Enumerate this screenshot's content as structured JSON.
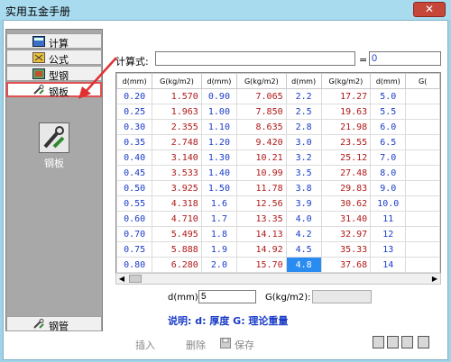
{
  "window": {
    "title": "实用五金手册",
    "close": "✕"
  },
  "nav": {
    "items": [
      {
        "label": "计算",
        "icon": "calculator-icon"
      },
      {
        "label": "公式",
        "icon": "formula-icon"
      },
      {
        "label": "型钢",
        "icon": "steel-section-icon"
      },
      {
        "label": "钢板",
        "icon": "wrench-icon"
      }
    ],
    "active_tool_label": "钢板",
    "bottom_item": {
      "label": "钢管",
      "icon": "wrench-icon"
    }
  },
  "calc": {
    "label": "计算式:",
    "expression": "",
    "equals": "=",
    "result": "0"
  },
  "grid": {
    "headers": [
      "d(mm)",
      "G(kg/m2)",
      "d(mm)",
      "G(kg/m2)",
      "d(mm)",
      "G(kg/m2)",
      "d(mm)",
      "G("
    ],
    "rows": [
      [
        "0.20",
        "1.570",
        "0.90",
        "7.065",
        "2.2",
        "17.27",
        "5.0",
        ""
      ],
      [
        "0.25",
        "1.963",
        "1.00",
        "7.850",
        "2.5",
        "19.63",
        "5.5",
        ""
      ],
      [
        "0.30",
        "2.355",
        "1.10",
        "8.635",
        "2.8",
        "21.98",
        "6.0",
        ""
      ],
      [
        "0.35",
        "2.748",
        "1.20",
        "9.420",
        "3.0",
        "23.55",
        "6.5",
        ""
      ],
      [
        "0.40",
        "3.140",
        "1.30",
        "10.21",
        "3.2",
        "25.12",
        "7.0",
        ""
      ],
      [
        "0.45",
        "3.533",
        "1.40",
        "10.99",
        "3.5",
        "27.48",
        "8.0",
        ""
      ],
      [
        "0.50",
        "3.925",
        "1.50",
        "11.78",
        "3.8",
        "29.83",
        "9.0",
        ""
      ],
      [
        "0.55",
        "4.318",
        "1.6",
        "12.56",
        "3.9",
        "30.62",
        "10.0",
        ""
      ],
      [
        "0.60",
        "4.710",
        "1.7",
        "13.35",
        "4.0",
        "31.40",
        "11",
        ""
      ],
      [
        "0.70",
        "5.495",
        "1.8",
        "14.13",
        "4.2",
        "32.97",
        "12",
        ""
      ],
      [
        "0.75",
        "5.888",
        "1.9",
        "14.92",
        "4.5",
        "35.33",
        "13",
        ""
      ],
      [
        "0.80",
        "6.280",
        "2.0",
        "15.70",
        "4.8",
        "37.68",
        "14",
        ""
      ]
    ],
    "selected": {
      "row": 11,
      "col": 4
    }
  },
  "form": {
    "d_label": "d(mm):",
    "d_value": "5",
    "g_label": "G(kg/m2):",
    "g_value": "",
    "note": "说明: d: 厚度  G: 理论重量"
  },
  "toolbar": {
    "insert": "插入",
    "delete": "删除",
    "save": "保存"
  },
  "colors": {
    "accent": "#2a8cf0",
    "d_text": "#1a3cc8",
    "g_text": "#b01818",
    "active_border": "#e05050"
  }
}
